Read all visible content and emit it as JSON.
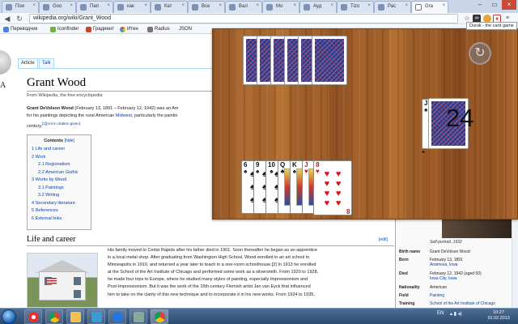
{
  "browser": {
    "tabs": [
      {
        "label": "Пои"
      },
      {
        "label": "Goo"
      },
      {
        "label": "Пап"
      },
      {
        "label": "как"
      },
      {
        "label": "Кат"
      },
      {
        "label": "Все"
      },
      {
        "label": "Вал"
      },
      {
        "label": "Мо"
      },
      {
        "label": "Ауд"
      },
      {
        "label": "Tizo"
      },
      {
        "label": "Рас"
      },
      {
        "label": "Gra"
      }
    ],
    "url": "wikipedia.org/wiki/Grant_Wood",
    "bookmarks": [
      {
        "label": "Переводчик"
      },
      {
        "label": "Iconfinder"
      },
      {
        "label": "Градиент"
      },
      {
        "label": "Итен"
      },
      {
        "label": "Radius"
      },
      {
        "label": "JSON"
      }
    ]
  },
  "wiki": {
    "logo_letter": "A",
    "tabs": [
      "Article",
      "Talk"
    ],
    "title": "Grant Wood",
    "tagline": "From Wikipedia, the free encyclopedia",
    "lead_name": "Grant DeVolson Wood",
    "lead_1": " (February 13, 1891 – February 12, 1942) was an Am",
    "lead_2": "for his paintings depicting the rural American ",
    "lead_link": "Midwest",
    "lead_3": ", particularly the paintin",
    "lead_4": "century.",
    "lead_cite": "[1][not in citation given]",
    "toc": {
      "title": "Contents",
      "hide": "[hide]",
      "items": [
        {
          "label": "1 Life and career",
          "level": 1
        },
        {
          "label": "2 Work",
          "level": 1
        },
        {
          "label": "2.1 Regionalism",
          "level": 2
        },
        {
          "label": "2.2 American Gothic",
          "level": 2
        },
        {
          "label": "3 Works by Wood",
          "level": 1
        },
        {
          "label": "3.1 Paintings",
          "level": 2
        },
        {
          "label": "3.2 Writing",
          "level": 2
        },
        {
          "label": "4 Secondary literature",
          "level": 1
        },
        {
          "label": "5 References",
          "level": 1
        },
        {
          "label": "6 External links",
          "level": 1
        }
      ]
    },
    "section_title": "Life and career",
    "section_edit": "[edit]",
    "body": [
      "His family moved to Cedar Rapids after his father died in 1901. Soon thereafter he began as an apprentice",
      "in a local metal shop. After graduating from Washington High School, Wood enrolled in an art school in",
      "Minneapolis in 1910, and returned a year later to teach in a one-room schoolhouse.[2] In 1913 he enrolled",
      "at the School of the Art Institute of Chicago and performed some work as a silversmith. From 1920 to 1928,",
      "he made four trips to Europe, where he studied many styles of painting, especially Impressionism and",
      "Post-Impressionism. But it was the work of the 15th-century Flemish artist Jan van Eyck that influenced",
      "him to take on the clarity of this new technique and to incorporate it in his new works. From 1924 to 1935,"
    ],
    "infobox": {
      "caption": "Self-portrait, 1932",
      "rows": [
        {
          "label": "Birth name",
          "value": "Grant DeVolson Wood",
          "sub": ""
        },
        {
          "label": "Born",
          "value": "February 13, 1891",
          "sub": "Anamosa, Iowa"
        },
        {
          "label": "Died",
          "value": "February 12, 1942 (aged 50)",
          "sub": "Iowa City, Iowa"
        },
        {
          "label": "Nationality",
          "value": "American",
          "sub": ""
        },
        {
          "label": "Field",
          "value": "Painting",
          "sub": ""
        },
        {
          "label": "Training",
          "value": "School of the Art Institute of Chicago",
          "sub": ""
        }
      ]
    }
  },
  "durak": {
    "tooltip": "Durak - the card game",
    "deck_count": "24",
    "trump_card": {
      "rank": "J",
      "suit": "♠"
    },
    "opponent_card_count": 6,
    "hand": [
      {
        "rank": "6",
        "suit": "♠",
        "color": "black"
      },
      {
        "rank": "9",
        "suit": "♠",
        "color": "black"
      },
      {
        "rank": "10",
        "suit": "♠",
        "color": "black"
      },
      {
        "rank": "Q",
        "suit": "♣",
        "color": "black"
      },
      {
        "rank": "K",
        "suit": "♠",
        "color": "black"
      },
      {
        "rank": "J",
        "suit": "♥",
        "color": "red"
      },
      {
        "rank": "8",
        "suit": "♥",
        "color": "red"
      }
    ]
  },
  "taskbar": {
    "lang": "EN",
    "time": "10:27",
    "date": "10.02.2013"
  }
}
